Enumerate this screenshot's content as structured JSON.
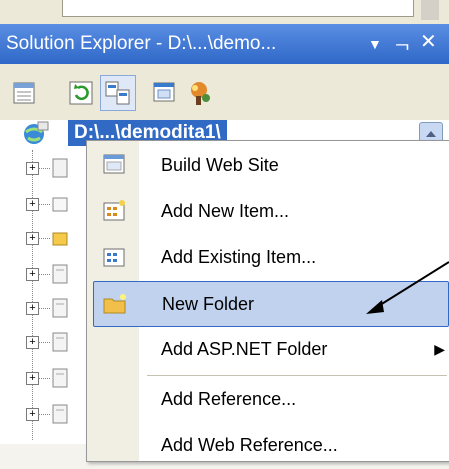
{
  "window": {
    "title": "Solution Explorer - D:\\...\\demo...",
    "dropdown_icon": "dropdown-arrow-icon",
    "pin_icon": "pin-icon",
    "close_icon": "close-icon"
  },
  "toolbar": {
    "buttons": [
      {
        "name": "properties-icon"
      },
      {
        "name": "refresh-icon"
      },
      {
        "name": "nest-related-files-icon"
      },
      {
        "name": "view-designer-icon"
      },
      {
        "name": "asp-net-configuration-icon"
      }
    ]
  },
  "tree": {
    "root_label": "D:\\...\\demodita1\\"
  },
  "context_menu": {
    "items": [
      {
        "label": "Build Web Site",
        "icon": "build-web-site-icon"
      },
      {
        "label": "Add New Item...",
        "icon": "add-new-item-icon"
      },
      {
        "label": "Add Existing Item...",
        "icon": "add-existing-item-icon"
      },
      {
        "label": "New Folder",
        "icon": "new-folder-icon",
        "highlighted": true
      },
      {
        "label": "Add ASP.NET Folder",
        "icon": "none",
        "submenu": true
      },
      {
        "label": "Add Reference...",
        "icon": "none"
      },
      {
        "label": "Add Web Reference...",
        "icon": "none"
      }
    ],
    "submenu_arrow": "▶"
  },
  "colors": {
    "title_bar": "#2f68c8",
    "selection": "#316ac5",
    "menu_highlight": "#c1d2ee"
  }
}
